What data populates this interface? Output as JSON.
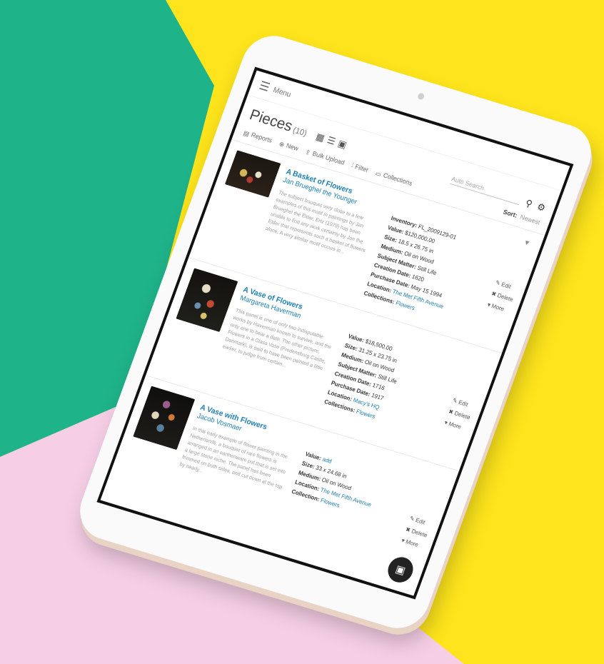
{
  "nav": {
    "menu_label": "Menu",
    "menu_icon": "hamburger-icon"
  },
  "header": {
    "title": "Pieces",
    "count": "(10)",
    "search_placeholder": "Auto Search",
    "search_inline_placeholder": "Auto Search"
  },
  "toolbar": {
    "reports_label": "Reports",
    "new_label": "New",
    "bulk_upload_label": "Bulk Upload",
    "filter_label": "Filter",
    "collections_label": "Collections",
    "sort_label": "Sort:",
    "sort_value": "Newest"
  },
  "pieces": [
    {
      "title": "A Basket of Flowers",
      "artist": "Jan Brueghel the Younger",
      "description": "The subject bouquet very close to a few examples of this motif in paintings by Jan Brueghel the Elder. Ertz (1979) has been unable to find any work certainly by Jan the Elder that represents such a basket of flowers alone. A very similar motif occurs in...",
      "meta": [
        {
          "key": "Inventory:",
          "value": "FL_2009129-01",
          "link": false
        },
        {
          "key": "Value:",
          "value": "$120,000.00",
          "link": false
        },
        {
          "key": "Size:",
          "value": "18.5 x 26.75 in",
          "link": false
        },
        {
          "key": "Medium:",
          "value": "Oil on Wood",
          "link": false
        },
        {
          "key": "Subject Matter:",
          "value": "Still Life",
          "link": false
        },
        {
          "key": "Creation Date:",
          "value": "1620",
          "link": false
        },
        {
          "key": "Purchase Date:",
          "value": "May 15 1994",
          "link": false
        },
        {
          "key": "Location:",
          "value": "The Met Fifth Avenue",
          "link": true
        },
        {
          "key": "Collections:",
          "value": "Flowers",
          "link": true
        }
      ],
      "actions": {
        "edit": "Edit",
        "delete": "Delete",
        "more": "More"
      }
    },
    {
      "title": "A Vase of Flowers",
      "artist": "Margareta Haverman",
      "description": "This panel is one of only two indisputable works by Haverman known to survive, and the only one to bear a date. The other picture, Flowers in a Glass Vase (Fredensborg Castle, Denmark), is said to have been painted a little earlier, to judge from certain...",
      "meta": [
        {
          "key": "Value:",
          "value": "$18,500.00",
          "link": false
        },
        {
          "key": "Size:",
          "value": "31.25 x 23.75 in",
          "link": false
        },
        {
          "key": "Medium:",
          "value": "Oil on Wood",
          "link": false
        },
        {
          "key": "Subject Matter:",
          "value": "Still Life",
          "link": false
        },
        {
          "key": "Creation Date:",
          "value": "1716",
          "link": false
        },
        {
          "key": "Purchase Date:",
          "value": "1917",
          "link": false
        },
        {
          "key": "Location:",
          "value": "Macy's HQ",
          "link": true
        },
        {
          "key": "Collections:",
          "value": "Flowers",
          "link": true
        }
      ],
      "actions": {
        "edit": "Edit",
        "delete": "Delete",
        "more": "More"
      }
    },
    {
      "title": "A Vase with Flowers",
      "artist": "Jacob Vosmaer",
      "description": "In this early example of flower painting in the Netherlands, a bouquet of rare flowers is arranged in an earthenware pot that is set into a large stone niche. The panel has been trimmed on both sides, and cut down at the top by nearly...",
      "meta": [
        {
          "key": "Value:",
          "value": "add",
          "link": true
        },
        {
          "key": "Size:",
          "value": "33 x 24.68 in",
          "link": false
        },
        {
          "key": "Medium:",
          "value": "Oil on Wood",
          "link": false
        },
        {
          "key": "Location:",
          "value": "The Met Fifth Avenue",
          "link": true
        },
        {
          "key": "Collection:",
          "value": "Flowers",
          "link": true
        }
      ],
      "actions": {
        "edit": "Edit",
        "delete": "Delete",
        "more": "More"
      }
    }
  ],
  "colors": {
    "link": "#1e7fb0",
    "green": "#1fb389",
    "yellow": "#fde41c",
    "pink": "#f6cfe6"
  }
}
